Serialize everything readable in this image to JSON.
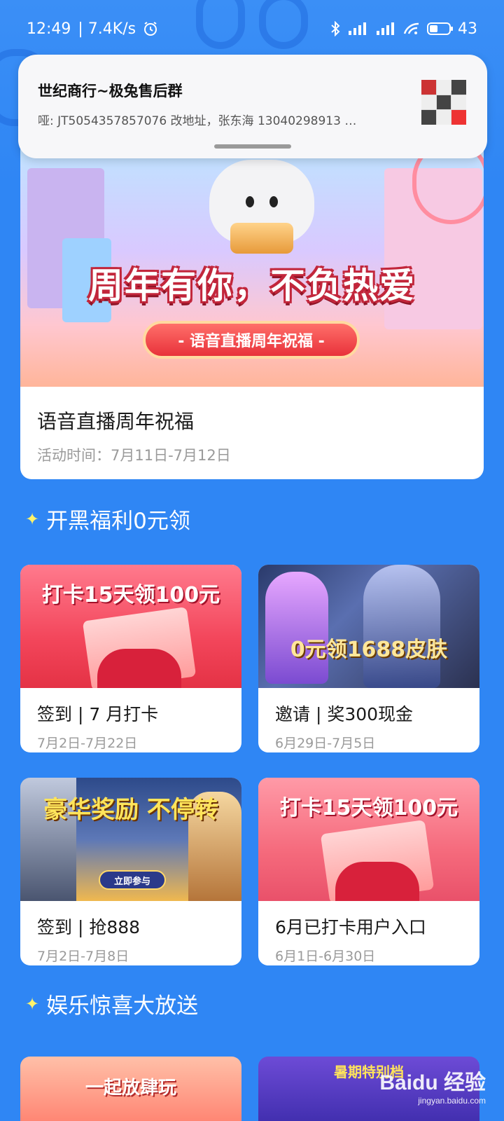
{
  "status_bar": {
    "time": "12:49",
    "speed": "| 7.4K/s",
    "battery": "43",
    "battery_level": 0.43
  },
  "notification": {
    "title": "世纪商行~极兔售后群",
    "body": "哑: JT5054357857076  改地址，张东海 13040298913 …"
  },
  "hero": {
    "banner_title": "周年有你，不负热爱",
    "banner_sub": "- 语音直播周年祝福 -",
    "name": "语音直播周年祝福",
    "time": "活动时间：7月11日-7月12日"
  },
  "sections": {
    "welfare": "开黑福利0元领",
    "fun": "娱乐惊喜大放送"
  },
  "cards": [
    {
      "img_text": "打卡15天领100元",
      "name": "签到 |  7 月打卡",
      "time": "7月2日-7月22日"
    },
    {
      "img_text": "0元领1688皮肤",
      "name": "邀请 | 奖300现金",
      "time": "6月29日-7月5日"
    },
    {
      "img_text": "豪华奖励 不停转",
      "img_button": "立即参与",
      "name": "签到 | 抢888",
      "time": "7月2日-7月8日"
    },
    {
      "img_text": "打卡15天领100元",
      "name": "6月已打卡用户入口",
      "time": "6月1日-6月30日"
    }
  ],
  "bottom_cards": [
    {
      "img_text": "一起放肆玩"
    },
    {
      "img_text": "暑期特别档"
    }
  ],
  "watermark": {
    "main": "Baidu 经验",
    "sub": "jingyan.baidu.com"
  },
  "colors": {
    "background": "#2f86f4",
    "card": "#ffffff",
    "accent_red": "#e8323a"
  }
}
